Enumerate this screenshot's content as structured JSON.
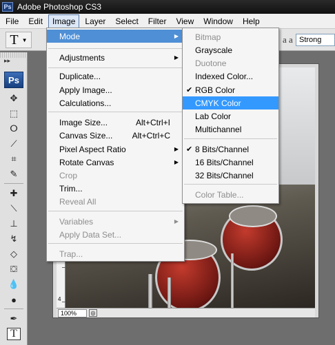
{
  "app": {
    "title": "Adobe Photoshop CS3",
    "logo_icon": "photoshop-logo-icon"
  },
  "menubar": {
    "items": [
      "File",
      "Edit",
      "Image",
      "Layer",
      "Select",
      "Filter",
      "View",
      "Window",
      "Help"
    ],
    "active": "Image"
  },
  "options": {
    "tool_glyph": "T",
    "antialias_glyph": "a a",
    "antialias_value": "Strong"
  },
  "tools": {
    "badge": "Ps",
    "icons": [
      "move-icon",
      "marquee-icon",
      "lasso-icon",
      "magic-wand-icon",
      "crop-icon",
      "slice-icon",
      "healing-brush-icon",
      "brush-icon",
      "clone-stamp-icon",
      "history-brush-icon",
      "eraser-icon",
      "paint-bucket-icon",
      "blur-icon",
      "dodge-icon",
      "pen-icon",
      "type-icon"
    ]
  },
  "document": {
    "zoom": "100%",
    "ruler_label": "4"
  },
  "image_menu": {
    "items": [
      {
        "label": "Mode",
        "submenu": true,
        "highlighted": true
      },
      {
        "label": "Adjustments",
        "submenu": true
      },
      {
        "label": "Duplicate..."
      },
      {
        "label": "Apply Image..."
      },
      {
        "label": "Calculations..."
      },
      {
        "label": "Image Size...",
        "shortcut": "Alt+Ctrl+I"
      },
      {
        "label": "Canvas Size...",
        "shortcut": "Alt+Ctrl+C"
      },
      {
        "label": "Pixel Aspect Ratio",
        "submenu": true
      },
      {
        "label": "Rotate Canvas",
        "submenu": true
      },
      {
        "label": "Crop",
        "disabled": true
      },
      {
        "label": "Trim..."
      },
      {
        "label": "Reveal All",
        "disabled": true
      },
      {
        "label": "Variables",
        "submenu": true,
        "disabled": true
      },
      {
        "label": "Apply Data Set...",
        "disabled": true
      },
      {
        "label": "Trap...",
        "disabled": true
      }
    ]
  },
  "mode_menu": {
    "items": [
      {
        "label": "Bitmap",
        "disabled": true
      },
      {
        "label": "Grayscale"
      },
      {
        "label": "Duotone",
        "disabled": true
      },
      {
        "label": "Indexed Color..."
      },
      {
        "label": "RGB Color",
        "checked": true
      },
      {
        "label": "CMYK Color",
        "highlighted": true
      },
      {
        "label": "Lab Color"
      },
      {
        "label": "Multichannel"
      },
      {
        "label": "8 Bits/Channel",
        "checked": true
      },
      {
        "label": "16 Bits/Channel"
      },
      {
        "label": "32 Bits/Channel"
      },
      {
        "label": "Color Table...",
        "disabled": true
      }
    ]
  },
  "colors": {
    "menu_highlight": "#3399ff",
    "disabled_text": "#8d8d8d",
    "drum_red": "#8a1e17"
  }
}
